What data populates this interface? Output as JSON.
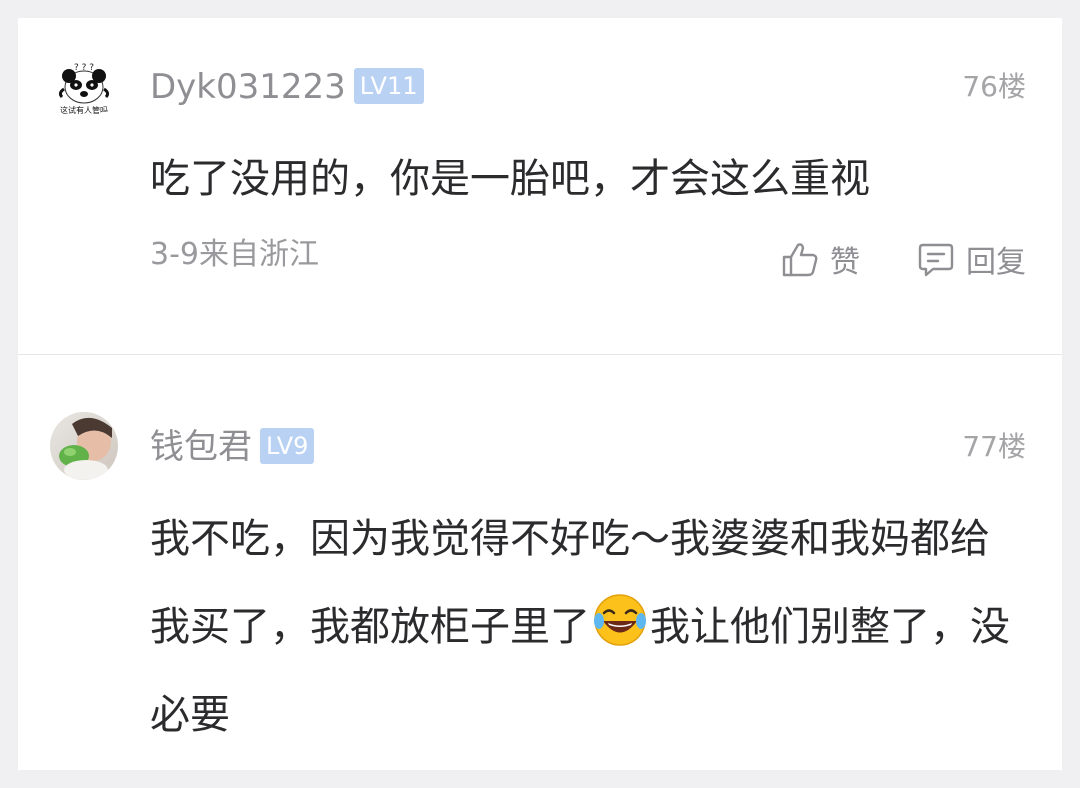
{
  "comments": [
    {
      "username": "Dyk031223",
      "level": "LV11",
      "floor": "76楼",
      "content": "吃了没用的，你是一胎吧，才会这么重视",
      "meta": "3-9来自浙江",
      "like_label": "赞",
      "reply_label": "回复",
      "avatar_caption": "这试有人管吗"
    },
    {
      "username": "钱包君",
      "level": "LV9",
      "floor": "77楼",
      "content_part1": "我不吃，因为我觉得不好吃～我婆婆和我妈都给我买了，我都放柜子里了",
      "content_part2": "我让他们别整了，没必要"
    }
  ],
  "colors": {
    "background": "#f0f0f2",
    "card": "#ffffff",
    "username": "#8e8e93",
    "badge": "#b9d2f3",
    "content": "#2b2b2e",
    "meta": "#9a9a9e"
  },
  "icons": [
    "thumbs-up-icon",
    "comment-bubble-icon",
    "laughing-crying-emoji"
  ]
}
